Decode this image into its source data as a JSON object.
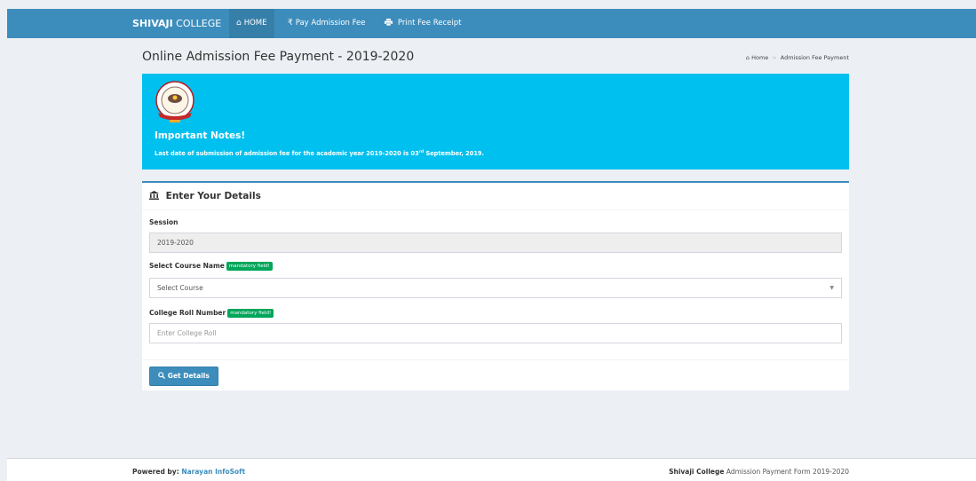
{
  "navbar": {
    "brand_bold": "SHIVAJI",
    "brand_rest": " COLLEGE",
    "items": [
      {
        "icon": "home-icon",
        "label": "HOME"
      },
      {
        "icon": "rupee-icon",
        "label": "Pay Admission Fee"
      },
      {
        "icon": "print-icon",
        "label": "Print Fee Receipt"
      }
    ]
  },
  "header": {
    "title": "Online Admission Fee Payment - 2019-2020",
    "breadcrumb": [
      "Home",
      "Admission Fee Payment"
    ]
  },
  "callout": {
    "title": "Important Notes!",
    "text_before": "Last date of submission of admission fee for the academic year 2019-2020 is 03",
    "text_sup": "rd",
    "text_after": " September, 2019."
  },
  "form": {
    "title": "Enter Your Details",
    "session_label": "Session",
    "session_value": "2019-2020",
    "course_label": "Select Course Name",
    "course_badge": "mandatory field!",
    "course_selected": "Select Course",
    "roll_label": "College Roll Number",
    "roll_badge": "mandatory field!",
    "roll_placeholder": "Enter College Roll",
    "submit_label": "Get Details"
  },
  "footer": {
    "powered_label": "Powered by: ",
    "powered_link": "Narayan InfoSoft",
    "right_bold": "Shivaji College",
    "right_rest": " Admission Payment Form 2019-2020"
  },
  "colors": {
    "primary": "#3c8dbc",
    "info": "#00c0ef",
    "success": "#00a65a"
  }
}
